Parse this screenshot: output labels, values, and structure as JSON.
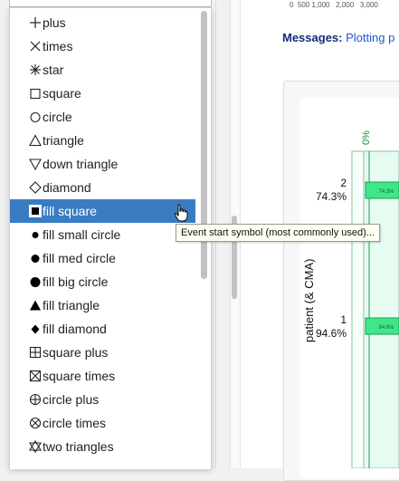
{
  "dropdown": {
    "options": [
      {
        "label": "plus",
        "icon": "plus-icon"
      },
      {
        "label": "times",
        "icon": "times-icon"
      },
      {
        "label": "star",
        "icon": "star-icon"
      },
      {
        "label": "square",
        "icon": "square-icon"
      },
      {
        "label": "circle",
        "icon": "circle-icon"
      },
      {
        "label": "triangle",
        "icon": "triangle-icon"
      },
      {
        "label": "down triangle",
        "icon": "down-triangle-icon"
      },
      {
        "label": "diamond",
        "icon": "diamond-icon"
      },
      {
        "label": "fill square",
        "icon": "fill-square-icon",
        "selected": true
      },
      {
        "label": "fill small circle",
        "icon": "fill-small-circle-icon"
      },
      {
        "label": "fill med circle",
        "icon": "fill-med-circle-icon"
      },
      {
        "label": "fill big circle",
        "icon": "fill-big-circle-icon"
      },
      {
        "label": "fill triangle",
        "icon": "fill-triangle-icon"
      },
      {
        "label": "fill diamond",
        "icon": "fill-diamond-icon"
      },
      {
        "label": "square plus",
        "icon": "square-plus-icon"
      },
      {
        "label": "square times",
        "icon": "square-times-icon"
      },
      {
        "label": "circle plus",
        "icon": "circle-plus-icon"
      },
      {
        "label": "circle times",
        "icon": "circle-times-icon"
      },
      {
        "label": "two triangles",
        "icon": "two-triangles-icon"
      }
    ],
    "selected_value": "fill square"
  },
  "tooltip": {
    "text": "Event start symbol (most commonly used)..."
  },
  "main": {
    "axis_ticks": "0  500 1,000   2,000   3,000",
    "messages_label": "Messages:",
    "messages_text": "Plotting p"
  },
  "plot": {
    "top_label": "0%",
    "y_axis_label": "patient (& CMA)",
    "patients": [
      {
        "id": "2",
        "cma": "74.3%",
        "bar_label": "74.3%"
      },
      {
        "id": "1",
        "cma": "94.6%",
        "bar_label": "94.6%"
      }
    ]
  },
  "colors": {
    "selection": "#3a7cc2",
    "messages_label": "#142b7a",
    "messages_text": "#1f57d6",
    "plot_fill": "#e6fbf1",
    "bar_fill": "#3ee889",
    "bar_stroke": "#1f9d55",
    "top_label": "#1a8a2a"
  }
}
